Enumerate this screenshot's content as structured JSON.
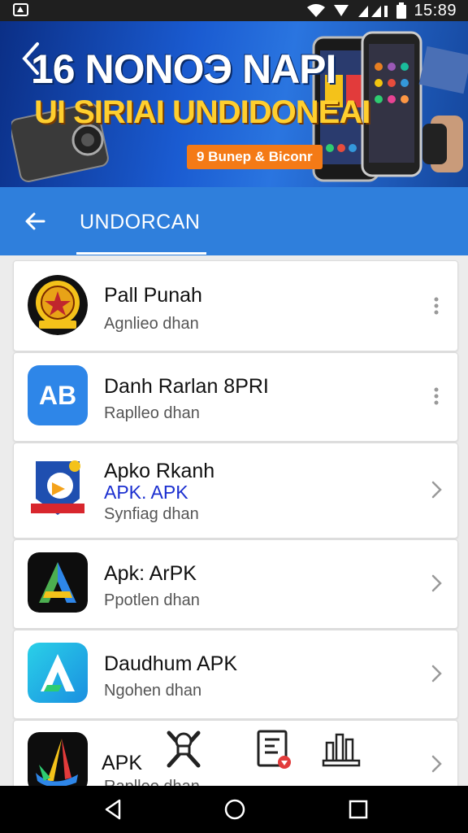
{
  "status_bar": {
    "time": "15:89",
    "icons": [
      "notification-icon",
      "wifi-icon",
      "signal-icon",
      "battery-icon"
    ]
  },
  "banner": {
    "line1": "16 NONOЭ NAPI",
    "line2": "UI SIRIAI UNDIDONEAI",
    "badge": "9 Bunep & Biconr"
  },
  "app_bar": {
    "title": "UNDORCAN"
  },
  "apps": [
    {
      "name": "Pall Punah",
      "tag": "",
      "subtitle": "Agnlieo dhan",
      "action": "more-vert-icon",
      "icon": "crest-badge-icon"
    },
    {
      "name": "Danh Rarlan 8PRI",
      "tag": "",
      "subtitle": "Raplleo dhan",
      "action": "more-vert-icon",
      "icon_text": "AB"
    },
    {
      "name": "Apko Rkanh",
      "tag": "APK. APK",
      "subtitle": "Synfiag dhan",
      "action": "chevron-right-icon",
      "icon": "mascot-shield-icon"
    },
    {
      "name": "Apk: ArPK",
      "tag": "",
      "subtitle": "Ppotlen dhan",
      "action": "chevron-right-icon",
      "icon": "triangle-a-icon"
    },
    {
      "name": "Daudhum APK",
      "tag": "",
      "subtitle": "Ngohen dhan",
      "action": "chevron-right-icon",
      "icon": "blue-a-icon"
    },
    {
      "name": "APK",
      "tag": "",
      "subtitle": "Raplleo dhan",
      "action": "chevron-right-icon",
      "icon": "multicolor-a-icon"
    }
  ],
  "overlay_icons": [
    "crossed-tools-icon",
    "document-icon",
    "building-chart-icon"
  ],
  "nav": {
    "buttons": [
      "back-triangle-icon",
      "home-circle-icon",
      "recents-square-icon"
    ]
  },
  "colors": {
    "app_bar": "#2f7fdc",
    "nav": "#000000",
    "accent_orange": "#f47a16"
  }
}
